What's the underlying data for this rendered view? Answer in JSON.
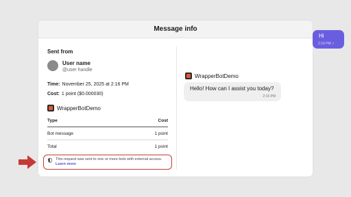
{
  "modal": {
    "title": "Message info"
  },
  "sender": {
    "section_label": "Sent from",
    "user_name": "User name",
    "user_handle": "@user handle",
    "time_label": "Time:",
    "time_value": "November 25, 2025 at 2:16 PM",
    "cost_label": "Cost:",
    "cost_value": "1 point ($0.000030)"
  },
  "bot": {
    "name": "WrapperBotDemo"
  },
  "cost_table": {
    "headers": [
      "Type",
      "Cost"
    ],
    "rows": [
      {
        "type": "Bot message",
        "cost": "1 point"
      },
      {
        "type": "Total",
        "cost": "1 point"
      }
    ]
  },
  "notice": {
    "text": "This request was sent to one or more bots with external access.",
    "link": "Learn more"
  },
  "chat": {
    "outgoing": {
      "text": "Hi",
      "time": "2:16 PM"
    },
    "incoming": {
      "bot_name": "WrapperBotDemo",
      "text": "Hello! How can I assist you today?",
      "time": "2:16 PM"
    }
  },
  "colors": {
    "accent": "#6a5ee0",
    "annotation_red": "#c53a36",
    "link": "#5553d4"
  },
  "icons": {
    "bot": "bot-avatar-icon",
    "notice": "shield-icon",
    "delivered": "check-icon",
    "annotation": "arrow-right-icon"
  }
}
